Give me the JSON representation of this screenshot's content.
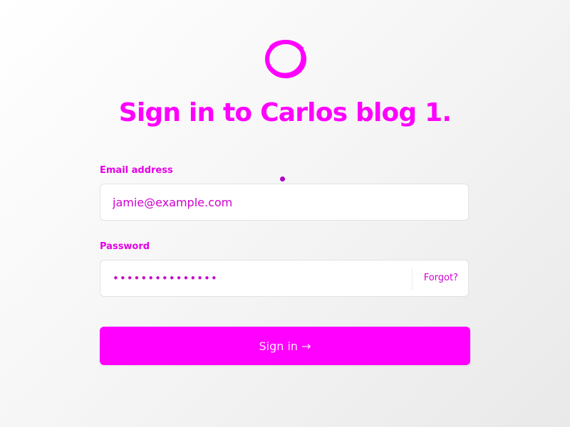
{
  "brand": {
    "logo_icon": "circle-logo-icon",
    "accent_color": "#ff00ff"
  },
  "page": {
    "title": "Sign in to Carlos blog 1."
  },
  "form": {
    "email": {
      "label": "Email address",
      "placeholder": "jamie@example.com",
      "value": ""
    },
    "password": {
      "label": "Password",
      "value": "•••••••••••••••",
      "forgot_label": "Forgot?"
    },
    "submit_label": "Sign in →"
  }
}
